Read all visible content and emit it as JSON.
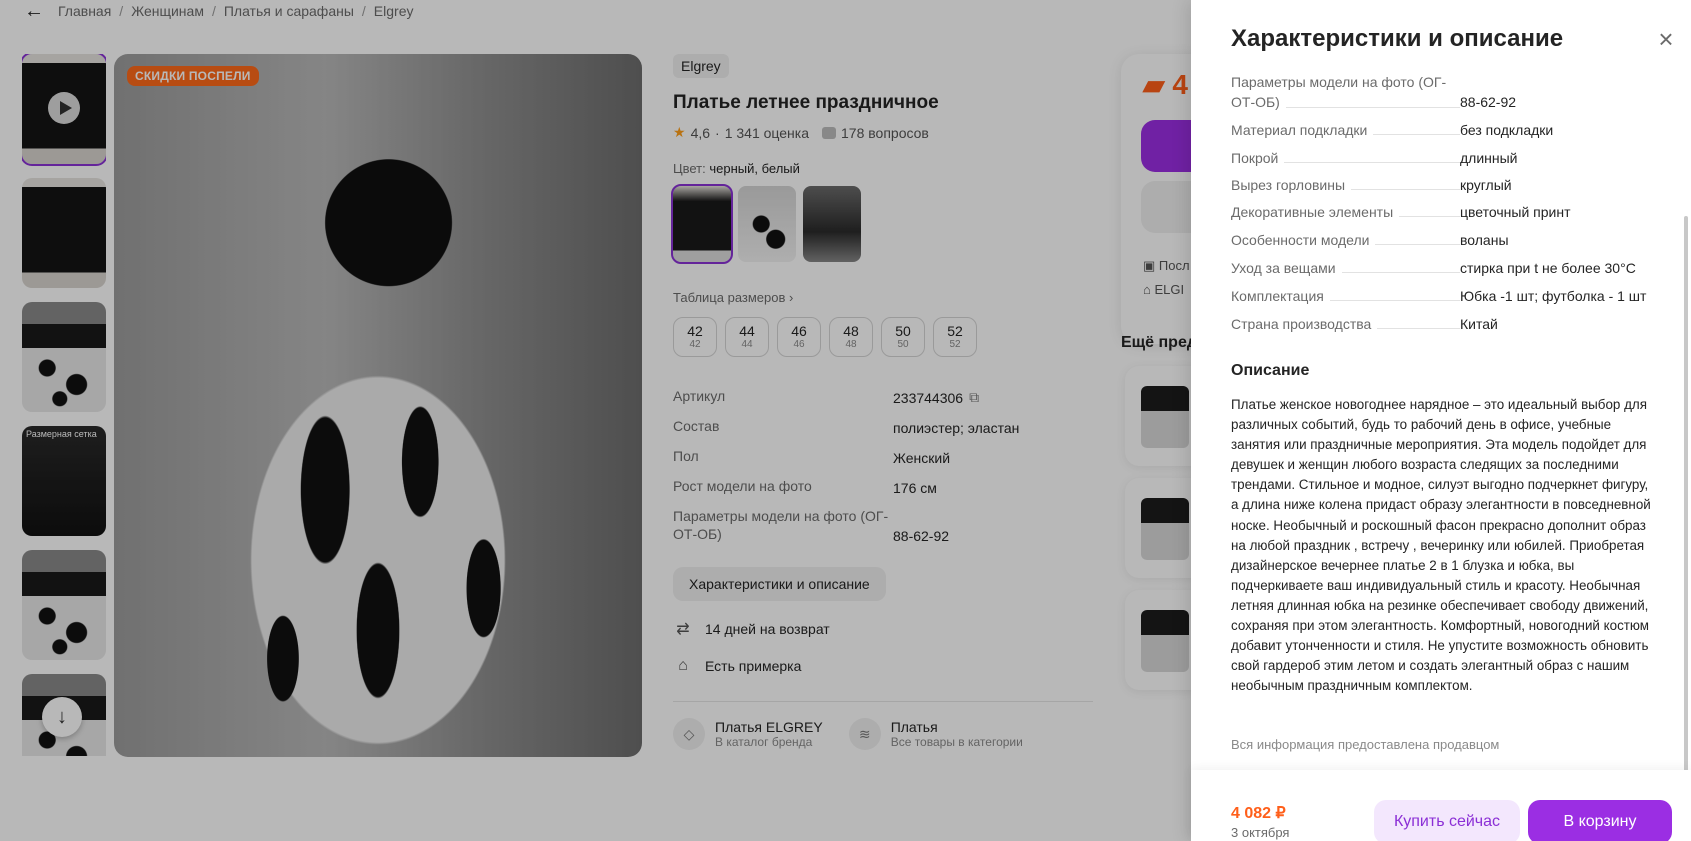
{
  "breadcrumbs": [
    "Главная",
    "Женщинам",
    "Платья и сарафаны",
    "Elgrey"
  ],
  "gallery": {
    "promo_badge": "СКИДКИ ПОСПЕЛИ",
    "size_chart_thumb_label": "Размерная сетка"
  },
  "product": {
    "brand": "Elgrey",
    "title": "Платье летнее праздничное",
    "rating": "4,6",
    "reviews": "1 341 оценка",
    "questions": "178 вопросов",
    "color_label": "Цвет:",
    "color_value": "черный, белый",
    "size_table_link": "Таблица размеров",
    "sizes": [
      {
        "ru": "42",
        "eu": "42"
      },
      {
        "ru": "44",
        "eu": "44"
      },
      {
        "ru": "46",
        "eu": "46"
      },
      {
        "ru": "48",
        "eu": "48"
      },
      {
        "ru": "50",
        "eu": "50"
      },
      {
        "ru": "52",
        "eu": "52"
      }
    ],
    "specs": [
      {
        "k": "Артикул",
        "v": "233744306"
      },
      {
        "k": "Состав",
        "v": "полиэстер; эластан"
      },
      {
        "k": "Пол",
        "v": "Женский"
      },
      {
        "k": "Рост модели на фото",
        "v": "176 см"
      },
      {
        "k": "Параметры модели на фото (ОГ-ОТ-ОБ)",
        "v": "88-62-92"
      }
    ],
    "char_button": "Характеристики и описание",
    "features": [
      "14 дней на возврат",
      "Есть примерка"
    ],
    "brand_links": [
      {
        "title": "Платья ELGREY",
        "sub": "В каталог бренда"
      },
      {
        "title": "Платья",
        "sub": "Все товары в категории"
      }
    ]
  },
  "buy_card": {
    "price_partial": "4",
    "line1": "Посл",
    "line2": "ELGI"
  },
  "more_title": "Ещё пред",
  "drawer": {
    "title": "Характеристики и описание",
    "rows": [
      {
        "k": "Параметры модели на фото (ОГ-ОТ-ОБ)",
        "v": "88-62-92"
      },
      {
        "k": "Материал подкладки",
        "v": "без подкладки"
      },
      {
        "k": "Покрой",
        "v": "длинный"
      },
      {
        "k": "Вырез горловины",
        "v": "круглый"
      },
      {
        "k": "Декоративные элементы",
        "v": "цветочный принт"
      },
      {
        "k": "Особенности модели",
        "v": "воланы"
      },
      {
        "k": "Уход за вещами",
        "v": "стирка при t не более 30°C"
      },
      {
        "k": "Комплектация",
        "v": "Юбка -1 шт; футболка - 1 шт"
      },
      {
        "k": "Страна производства",
        "v": "Китай"
      }
    ],
    "description_title": "Описание",
    "description": "Платье женское новогоднее нарядное – это идеальный выбор для различных событий, будь то рабочий день в офисе, учебные занятия или праздничные мероприятия. Эта модель подойдет для девушек и женщин любого возраста следящих за последними трендами. Стильное и модное, силуэт выгодно подчеркнет фигуру, а длина ниже колена придаст образу элегантности в повседневной носке. Необычный и роскошный фасон прекрасно дополнит образ на любой праздник , встречу , вечеринку или юбилей. Приобретая дизайнерское вечернее платье 2 в 1 блузка и юбка, вы подчеркиваете ваш индивидуальный стиль и красоту. Необычная летняя длинная юбка на резинке обеспечивает свободу движений, сохраняя при этом элегантность. Комфортный, новогодний костюм добавит утонченности и стиля. Не упустите возможность обновить свой гардероб этим летом и создать элегантный образ с нашим необычным праздничным комплектом.",
    "note": "Вся информация предоставлена продавцом",
    "footer": {
      "price": "4 082 ₽",
      "date": "3 октября",
      "buy_now": "Купить сейчас",
      "add_to_cart": "В корзину"
    }
  },
  "colors": {
    "accent": "#9b2ee3",
    "price": "#ff5f1a",
    "promo": "#ff6a1a"
  }
}
